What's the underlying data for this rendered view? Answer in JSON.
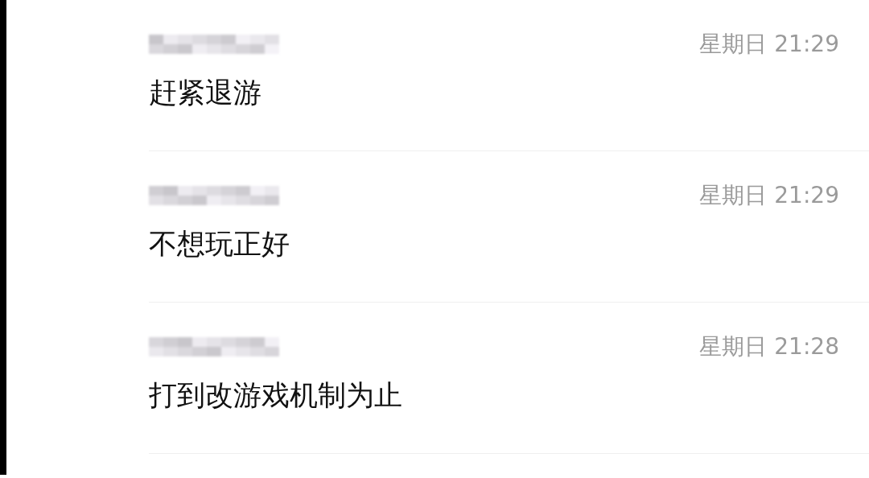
{
  "comments": [
    {
      "time": "星期日 21:29",
      "text": "赶紧退游"
    },
    {
      "time": "星期日 21:29",
      "text": "不想玩正好"
    },
    {
      "time": "星期日 21:28",
      "text": "打到改游戏机制为止"
    }
  ]
}
